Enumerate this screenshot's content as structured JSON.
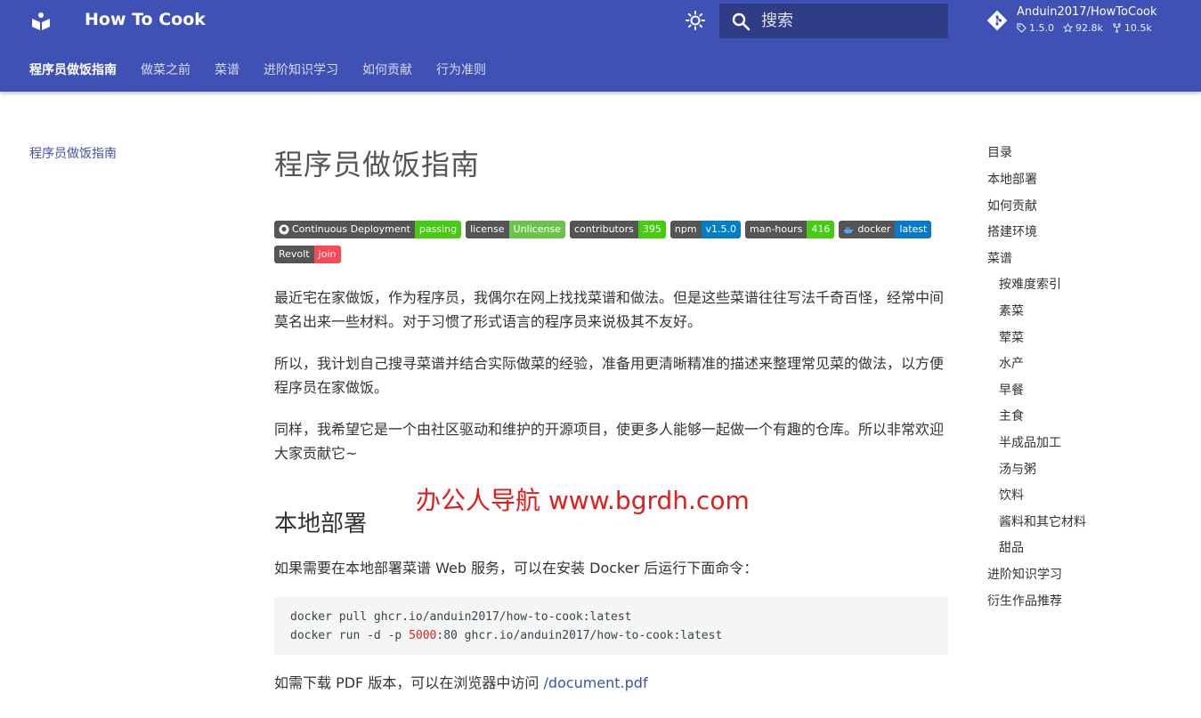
{
  "header": {
    "site_title": "How To Cook",
    "search_placeholder": "搜索",
    "repo": {
      "name": "Anduin2017/HowToCook",
      "version": "1.5.0",
      "stars": "92.8k",
      "forks": "10.5k"
    }
  },
  "tabs": [
    {
      "label": "程序员做饭指南"
    },
    {
      "label": "做菜之前"
    },
    {
      "label": "菜谱"
    },
    {
      "label": "进阶知识学习"
    },
    {
      "label": "如何贡献"
    },
    {
      "label": "行为准则"
    }
  ],
  "left_nav": {
    "item": "程序员做饭指南"
  },
  "content": {
    "title": "程序员做饭指南",
    "badges": [
      {
        "key": "Continuous Deployment",
        "value": "passing",
        "color": "#4c1"
      },
      {
        "key": "license",
        "value": "Unlicense",
        "color": "#6cc34b"
      },
      {
        "key": "contributors",
        "value": "395",
        "color": "#4c1"
      },
      {
        "key": "npm",
        "value": "v1.5.0",
        "color": "#007ec6"
      },
      {
        "key": "man-hours",
        "value": "416",
        "color": "#4c1"
      },
      {
        "key": "docker",
        "value": "latest",
        "color": "#0879c6"
      },
      {
        "key": "Revolt",
        "value": "Join",
        "color": "#ff4654"
      }
    ],
    "p1": "最近宅在家做饭，作为程序员，我偶尔在网上找找菜谱和做法。但是这些菜谱往往写法千奇百怪，经常中间莫名出来一些材料。对于习惯了形式语言的程序员来说极其不友好。",
    "p2": "所以，我计划自己搜寻菜谱并结合实际做菜的经验，准备用更清晰精准的描述来整理常见菜的做法，以方便程序员在家做饭。",
    "p3": "同样，我希望它是一个由社区驱动和维护的开源项目，使更多人能够一起做一个有趣的仓库。所以非常欢迎大家贡献它~",
    "h2": "本地部署",
    "p4": "如果需要在本地部署菜谱 Web 服务，可以在安装 Docker 后运行下面命令：",
    "code_line1": "docker pull ghcr.io/anduin2017/how-to-cook:latest",
    "code_line2_pre": "docker run -d -p ",
    "code_line2_num": "5000",
    "code_line2_post": ":80 ghcr.io/anduin2017/how-to-cook:latest",
    "p5_text": "如需下载 PDF 版本，可以在浏览器中访问 ",
    "p5_link": "/document.pdf"
  },
  "watermark": "办公人导航 www.bgrdh.com",
  "toc": {
    "title": "目录",
    "items": [
      {
        "label": "本地部署",
        "level": 1
      },
      {
        "label": "如何贡献",
        "level": 1
      },
      {
        "label": "搭建环境",
        "level": 1
      },
      {
        "label": "菜谱",
        "level": 1
      },
      {
        "label": "按难度索引",
        "level": 2
      },
      {
        "label": "素菜",
        "level": 2
      },
      {
        "label": "荤菜",
        "level": 2
      },
      {
        "label": "水产",
        "level": 2
      },
      {
        "label": "早餐",
        "level": 2
      },
      {
        "label": "主食",
        "level": 2
      },
      {
        "label": "半成品加工",
        "level": 2
      },
      {
        "label": "汤与粥",
        "level": 2
      },
      {
        "label": "饮料",
        "level": 2
      },
      {
        "label": "酱料和其它材料",
        "level": 2
      },
      {
        "label": "甜品",
        "level": 2
      },
      {
        "label": "进阶知识学习",
        "level": 1
      },
      {
        "label": "衍生作品推荐",
        "level": 1
      }
    ]
  }
}
